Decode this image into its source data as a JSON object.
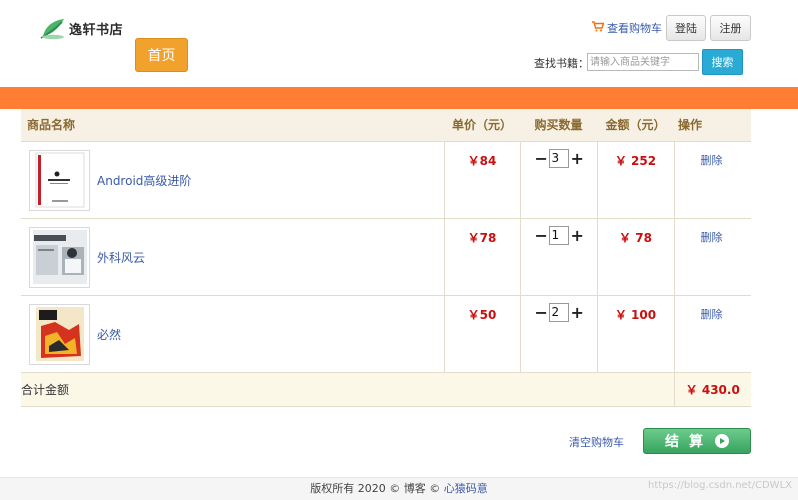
{
  "header": {
    "logo_text": "逸轩书店",
    "home_label": "首页",
    "cart_link": "查看购物车",
    "login_label": "登陆",
    "register_label": "注册",
    "search_label": "查找书籍：",
    "search_placeholder": "请输入商品关键字",
    "search_button": "搜索"
  },
  "colors": {
    "accent_orange": "#ff7e33",
    "home_button": "#f0a22c",
    "search_button": "#29abd6",
    "checkout_green": "#38a35f",
    "price_red": "#c8100f",
    "link_blue": "#3a5aa8"
  },
  "table": {
    "headers": {
      "name": "商品名称",
      "price": "单价（元）",
      "qty": "购买数量",
      "amount": "金额（元）",
      "op": "操作"
    },
    "rows": [
      {
        "name": "Android高级进阶",
        "price": "￥84",
        "qty": "3",
        "amount": "￥ 252",
        "op": "删除",
        "thumb_icon": "book-cover-android"
      },
      {
        "name": "外科风云",
        "price": "￥78",
        "qty": "1",
        "amount": "￥ 78",
        "op": "删除",
        "thumb_icon": "book-cover-waike"
      },
      {
        "name": "必然",
        "price": "￥50",
        "qty": "2",
        "amount": "￥ 100",
        "op": "删除",
        "thumb_icon": "book-cover-biran"
      }
    ],
    "total_label": "合计金额",
    "total_value": "￥ 430.0"
  },
  "actions": {
    "clear_cart": "清空购物车",
    "checkout": "结算"
  },
  "footer": {
    "copyright": "版权所有 2020 © 博客 ©",
    "brand": "心猿码意",
    "watermark": "https://blog.csdn.net/CDWLX"
  }
}
